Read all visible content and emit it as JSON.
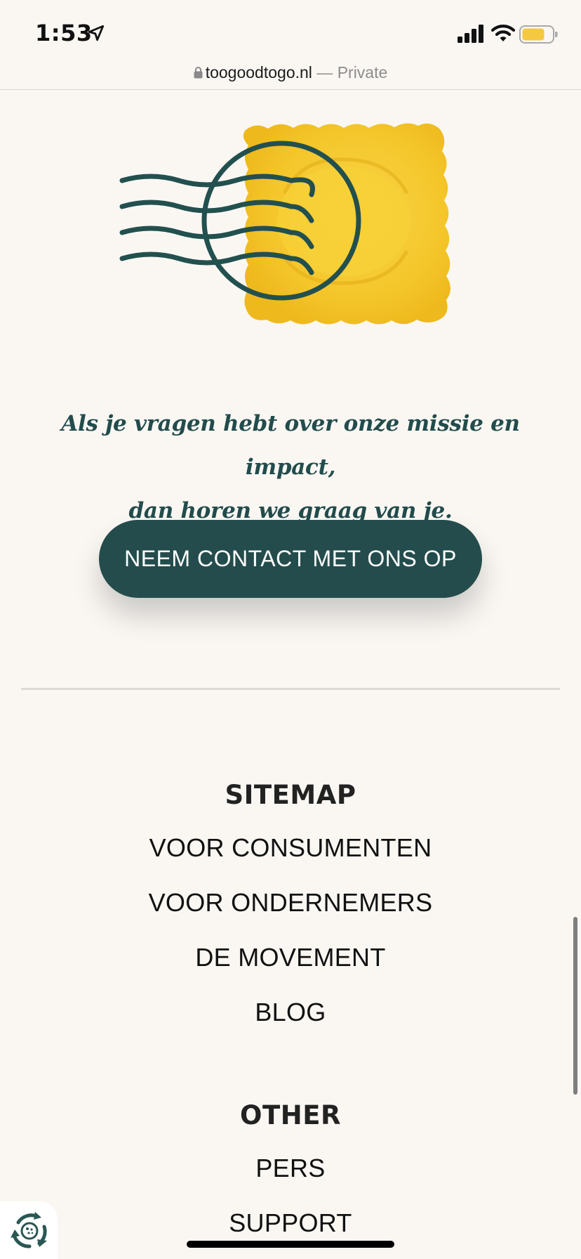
{
  "status_bar": {
    "time": "1:53",
    "icons": [
      "location-arrow-icon",
      "cellular-signal-icon",
      "wifi-icon",
      "battery-icon"
    ],
    "battery_color": "#f5c842"
  },
  "url_bar": {
    "domain": "toogoodtogo.nl",
    "separator": "—",
    "mode": "Private"
  },
  "illustration": {
    "icon": "ravioli-stamp-illustration",
    "colors": {
      "pasta": "#f6cd2b",
      "stamp": "#22504f"
    }
  },
  "contact": {
    "intro_line1": "Als je vragen hebt over onze missie en impact,",
    "intro_line2": "dan horen we graag van je.",
    "button_label": "NEEM CONTACT MET ONS OP",
    "button_color": "#244c4c"
  },
  "footer": {
    "sitemap": {
      "heading": "SITEMAP",
      "items": [
        "VOOR CONSUMENTEN",
        "VOOR ONDERNEMERS",
        "DE MOVEMENT",
        "BLOG"
      ]
    },
    "other": {
      "heading": "OTHER",
      "items": [
        "PERS",
        "SUPPORT"
      ]
    }
  },
  "floating_widget": {
    "icon": "recycle-food-icon"
  }
}
